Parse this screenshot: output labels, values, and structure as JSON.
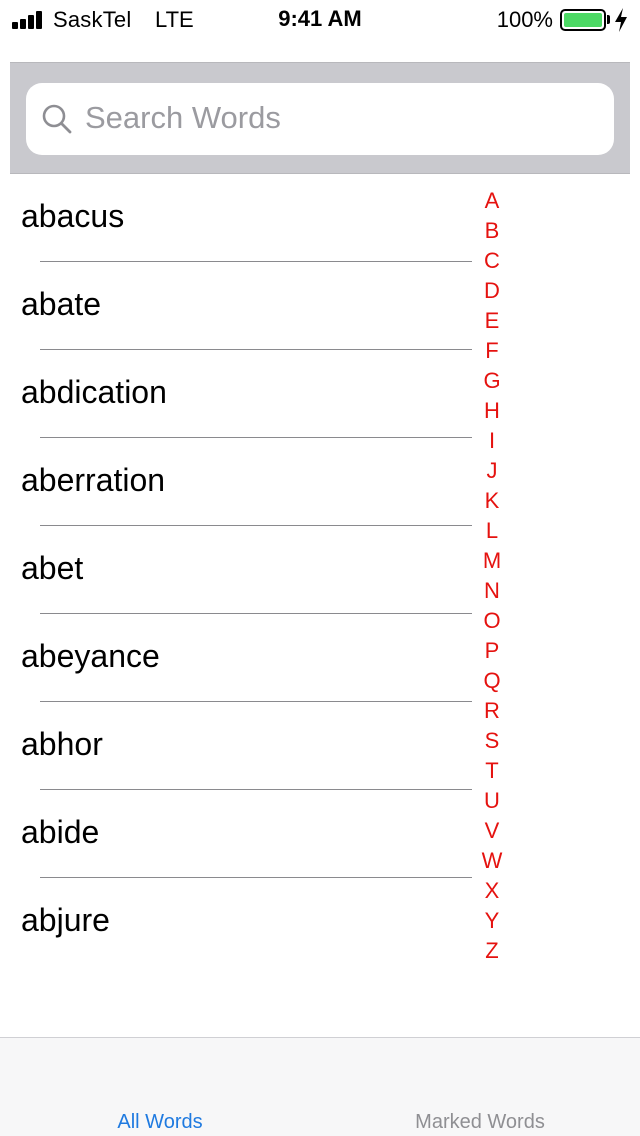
{
  "status_bar": {
    "carrier": "SaskTel",
    "network": "LTE",
    "time": "9:41 AM",
    "battery_percent": "100%",
    "battery_level": 1.0,
    "battery_color": "#4cd964"
  },
  "search": {
    "placeholder": "Search Words"
  },
  "words": [
    "abacus",
    "abate",
    "abdication",
    "aberration",
    "abet",
    "abeyance",
    "abhor",
    "abide",
    "abjure"
  ],
  "index_letters": [
    "A",
    "B",
    "C",
    "D",
    "E",
    "F",
    "G",
    "H",
    "I",
    "J",
    "K",
    "L",
    "M",
    "N",
    "O",
    "P",
    "Q",
    "R",
    "S",
    "T",
    "U",
    "V",
    "W",
    "X",
    "Y",
    "Z"
  ],
  "colors": {
    "index_accent": "#e5120f",
    "tab_active": "#1f7ae0",
    "tab_inactive": "#8f8f93"
  },
  "tab_bar": {
    "tabs": [
      {
        "label": "All Words",
        "active": true
      },
      {
        "label": "Marked Words",
        "active": false
      }
    ]
  }
}
